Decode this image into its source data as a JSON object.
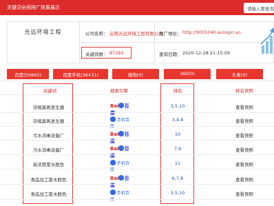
{
  "header": {
    "title": "关键词全网排广效果展示",
    "search_placeholder": "请输入要查询"
  },
  "company": {
    "logo_text": "光远环境工程",
    "name_label": "公司名称：",
    "name_value": "云南光远环境工程有限公司",
    "keyword_count_label": "关键词数：",
    "keyword_count_value": "87293",
    "promo_label": "推广地址：",
    "promo_value": "http://9005040.aulogin.yo",
    "query_time_label": "查询日期：",
    "query_time_value": "2020-12-28 21:15:09"
  },
  "tabs": [
    {
      "label": "百度(50862)"
    },
    {
      "label": "百度手机(36431)"
    },
    {
      "label": "搜狗(0)"
    },
    {
      "label": "360(0)"
    },
    {
      "label": "头条(0)"
    }
  ],
  "table": {
    "headers": [
      "关键词",
      "搜索引擎",
      "排名",
      "排名快照"
    ],
    "rows": [
      {
        "keyword": "浓缩臭氧发生器",
        "engine": "百度",
        "rank": "3,5,10",
        "snapshot": "查看快照"
      },
      {
        "keyword": "浓缩臭氧发生器",
        "engine": "手机百度",
        "rank": "3,4,8",
        "snapshot": "查看快照"
      },
      {
        "keyword": "污水消毒设备厂",
        "engine": "百度",
        "rank": "10",
        "snapshot": "查看快照"
      },
      {
        "keyword": "污水消毒设备厂",
        "engine": "百度",
        "rank": "7,9",
        "snapshot": "查看快照"
      },
      {
        "keyword": "高浓度废水脱色",
        "engine": "手机百度",
        "rank": "11",
        "snapshot": "查看快照"
      },
      {
        "keyword": "食品加工废水脱色",
        "engine": "百度",
        "rank": "6,7,8",
        "snapshot": "查看快照"
      },
      {
        "keyword": "食品加工废水脱色",
        "engine": "手机百度",
        "rank": "3,5,10",
        "snapshot": "查看快照"
      }
    ]
  },
  "colors": {
    "primary_red": "#dd2b2b",
    "rank_blue": "#1f4fa8",
    "baidu_blue": "#2932e1"
  }
}
